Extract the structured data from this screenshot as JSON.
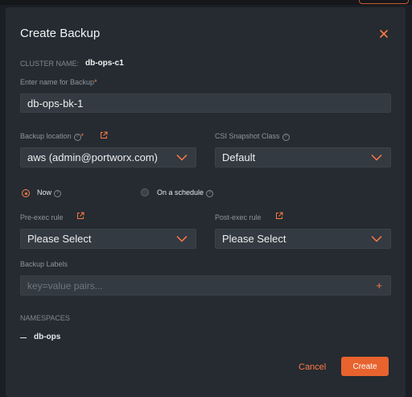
{
  "dialog": {
    "title": "Create Backup",
    "cluster_label": "CLUSTER NAME:",
    "cluster_value": "db-ops-c1"
  },
  "backup_name": {
    "label": "Enter name for Backup",
    "required_mark": "*",
    "value": "db-ops-bk-1"
  },
  "backup_location": {
    "label": "Backup location",
    "required_mark": "*",
    "value": "aws (admin@portworx.com)"
  },
  "csi_snapshot": {
    "label": "CSI Snapshot Class",
    "value": "Default"
  },
  "schedule": {
    "now_label": "Now",
    "schedule_label": "On a schedule",
    "selected": "Now"
  },
  "pre_exec": {
    "label": "Pre-exec rule",
    "value": "Please Select"
  },
  "post_exec": {
    "label": "Post-exec rule",
    "value": "Please Select"
  },
  "backup_labels": {
    "label": "Backup Labels",
    "placeholder": "key=value pairs...",
    "add_symbol": "+"
  },
  "namespaces": {
    "heading": "NAMESPACES",
    "items": [
      "db-ops"
    ]
  },
  "footer": {
    "cancel_label": "Cancel",
    "create_label": "Create"
  },
  "colors": {
    "accent": "#ff7a45",
    "primary_button": "#e8632e",
    "dialog_bg": "#252b31",
    "input_bg": "#333a41"
  }
}
